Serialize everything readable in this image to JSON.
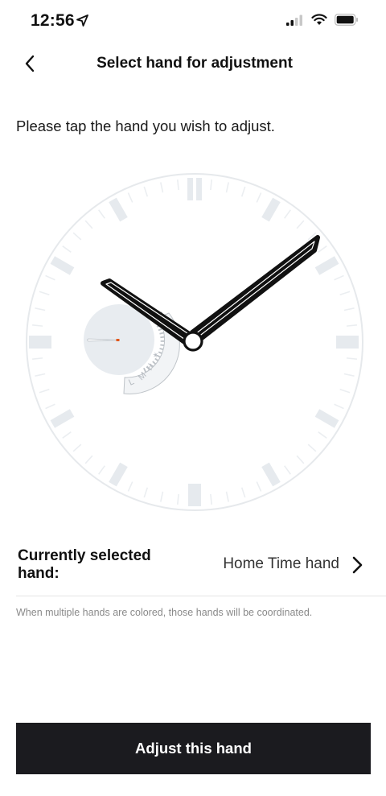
{
  "status_bar": {
    "time": "12:56",
    "icons": [
      "location-arrow-icon",
      "cellular-signal-icon",
      "wifi-icon",
      "battery-icon"
    ]
  },
  "nav": {
    "title": "Select hand for adjustment",
    "back_icon": "chevron-left-icon"
  },
  "instruction": "Please tap the hand you wish to adjust.",
  "watch_face": {
    "subdial_labels": [
      "L",
      "M",
      "H",
      "✶"
    ],
    "hands": [
      "hour-hand",
      "minute-hand",
      "subdial-hand"
    ]
  },
  "selection": {
    "label": "Currently selected hand:",
    "value": "Home Time hand"
  },
  "note": "When multiple hands are colored, those hands will be coordinated.",
  "primary_button": {
    "label": "Adjust this hand"
  },
  "colors": {
    "background": "#ffffff",
    "button_bg": "#1b1b1f",
    "button_text": "#ffffff",
    "dial_markers": "#e6eaee",
    "hands": "#111111",
    "subdial_hand_tip": "#e2571c"
  }
}
